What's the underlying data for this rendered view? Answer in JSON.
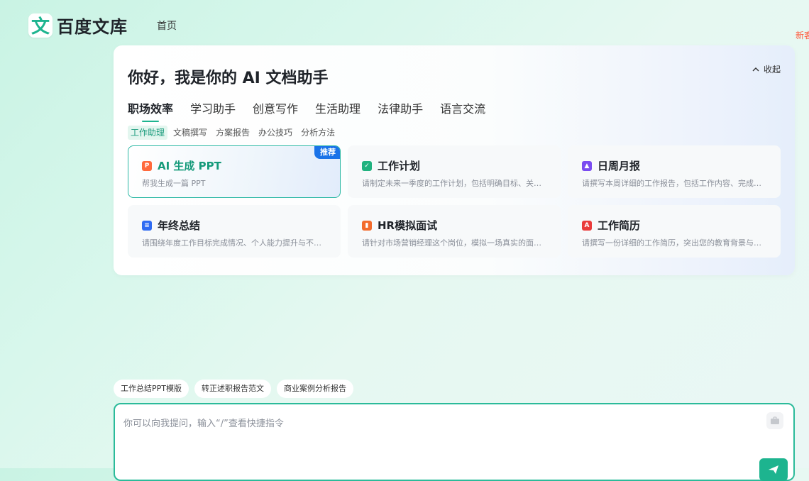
{
  "header": {
    "logo_mark": "文",
    "logo_text": "百度文库",
    "nav_home": "首页",
    "edge_text": "新客"
  },
  "panel": {
    "title": "你好，我是你的 AI 文档助手",
    "collapse_label": "收起",
    "tabs": [
      {
        "label": "职场效率",
        "active": true
      },
      {
        "label": "学习助手"
      },
      {
        "label": "创意写作"
      },
      {
        "label": "生活助理"
      },
      {
        "label": "法律助手"
      },
      {
        "label": "语言交流"
      }
    ],
    "subtabs": [
      {
        "label": "工作助理",
        "active": true
      },
      {
        "label": "文稿撰写"
      },
      {
        "label": "方案报告"
      },
      {
        "label": "办公技巧"
      },
      {
        "label": "分析方法"
      }
    ],
    "cards": [
      {
        "title": "AI 生成 PPT",
        "desc": "帮我生成一篇 PPT",
        "badge": "推荐",
        "icon": "ppt-icon",
        "icon_color": "#ff6a3d",
        "icon_glyph": "P"
      },
      {
        "title": "工作计划",
        "desc": "请制定未来一季度的工作计划，包括明确目标、关键任务与时间节点",
        "icon": "plan-check-icon",
        "icon_color": "#21b27f",
        "icon_glyph": "✓"
      },
      {
        "title": "日周月报",
        "desc": "请撰写本周详细的工作报告，包括工作内容、完成情况与下周计划",
        "icon": "report-icon",
        "icon_color": "#7a4cf0",
        "icon_glyph": "▲"
      },
      {
        "title": "年终总结",
        "desc": "请围绕年度工作目标完成情况、个人能力提升与不足进行总结",
        "icon": "summary-doc-icon",
        "icon_color": "#2f6bf2",
        "icon_glyph": "≡"
      },
      {
        "title": "HR模拟面试",
        "desc": "请针对市场营销经理这个岗位，模拟一场真实的面试场景",
        "icon": "interview-chart-icon",
        "icon_color": "#f36b2c",
        "icon_glyph": "▮"
      },
      {
        "title": "工作简历",
        "desc": "请撰写一份详细的工作简历，突出您的教育背景与工作经历",
        "icon": "resume-pdf-icon",
        "icon_color": "#ea3b3b",
        "icon_glyph": "A"
      }
    ]
  },
  "suggestions": [
    "工作总结PPT模版",
    "转正述职报告范文",
    "商业案例分析报告"
  ],
  "composer": {
    "placeholder": "你可以向我提问，输入“/”查看快捷指令"
  },
  "colors": {
    "accent": "#1db48f",
    "badge": "#1a73e8",
    "background_start": "#c9f3e4"
  }
}
